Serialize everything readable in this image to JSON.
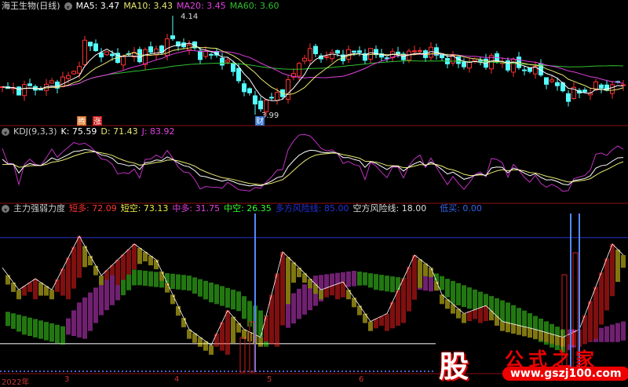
{
  "price_panel": {
    "title": "海王生物(日线)",
    "ma5": "MA5: 3.47",
    "ma10": "MA10: 3.43",
    "ma20": "MA20: 3.45",
    "ma60": "MA60: 3.60",
    "high_label": "4.14",
    "low_label": "3.99",
    "markers": [
      "腾",
      "涨",
      "财"
    ]
  },
  "kdj_panel": {
    "title": "KDJ(9,3,3)",
    "k": "K: 75.59",
    "d": "D: 71.43",
    "j": "J: 83.92"
  },
  "force_panel": {
    "title": "主力强弱力度",
    "short_long": "短多: 72.09",
    "short_short": "短空: 73.13",
    "mid_long": "中多: 31.75",
    "mid_short": "中空: 26.35",
    "bull_risk": "多方风险线: 85.00",
    "bear_risk": "空方风险线: 18.00",
    "low_buy": "低买: 0.00"
  },
  "x_axis": [
    "2022年",
    "3",
    "4",
    "5",
    "6"
  ],
  "watermark": {
    "logo": "股",
    "title": "公式之家",
    "url": "www.gszj100.com"
  },
  "colors": {
    "up": "#ff3232",
    "down": "#54ffff",
    "ma5": "#ffffff",
    "ma10": "#e8e870",
    "ma20": "#e040e0",
    "ma60": "#30c030"
  },
  "chart_data": {
    "type": "candlestick",
    "price_keypoints": [
      [
        0,
        3.45
      ],
      [
        8,
        3.48
      ],
      [
        13,
        3.6
      ],
      [
        15,
        3.88
      ],
      [
        20,
        3.75
      ],
      [
        27,
        3.8
      ],
      [
        31,
        3.92
      ],
      [
        36,
        3.8
      ],
      [
        40,
        3.75
      ],
      [
        43,
        3.55
      ],
      [
        46,
        3.3
      ],
      [
        49,
        3.36
      ],
      [
        52,
        3.5
      ],
      [
        55,
        3.8
      ],
      [
        59,
        3.77
      ],
      [
        64,
        3.8
      ],
      [
        71,
        3.77
      ],
      [
        77,
        3.82
      ],
      [
        83,
        3.7
      ],
      [
        89,
        3.73
      ],
      [
        97,
        3.63
      ],
      [
        103,
        3.4
      ],
      [
        108,
        3.47
      ],
      [
        113,
        3.5
      ]
    ],
    "short_line": [
      [
        0,
        66
      ],
      [
        3,
        52
      ],
      [
        6,
        59
      ],
      [
        9,
        52
      ],
      [
        14,
        86
      ],
      [
        18,
        61
      ],
      [
        24,
        81
      ],
      [
        28,
        71
      ],
      [
        34,
        27
      ],
      [
        38,
        17
      ],
      [
        41,
        39
      ],
      [
        44,
        27
      ],
      [
        47,
        22
      ],
      [
        51,
        76
      ],
      [
        54,
        66
      ],
      [
        58,
        52
      ],
      [
        62,
        57
      ],
      [
        67,
        32
      ],
      [
        70,
        37
      ],
      [
        75,
        74
      ],
      [
        78,
        66
      ],
      [
        80,
        49
      ],
      [
        84,
        37
      ],
      [
        88,
        42
      ],
      [
        91,
        32
      ],
      [
        97,
        27
      ],
      [
        102,
        22
      ],
      [
        105,
        27
      ],
      [
        111,
        81
      ],
      [
        113,
        74
      ]
    ],
    "mid_line": [
      [
        0,
        39
      ],
      [
        11,
        29
      ],
      [
        14,
        44
      ],
      [
        21,
        66
      ],
      [
        34,
        61
      ],
      [
        43,
        51
      ],
      [
        48,
        36
      ],
      [
        57,
        61
      ],
      [
        64,
        64
      ],
      [
        74,
        59
      ],
      [
        78,
        64
      ],
      [
        81,
        59
      ],
      [
        92,
        44
      ],
      [
        102,
        27
      ],
      [
        108,
        27
      ],
      [
        113,
        32
      ]
    ],
    "bull_risk": 85,
    "bear_risk": 18
  }
}
